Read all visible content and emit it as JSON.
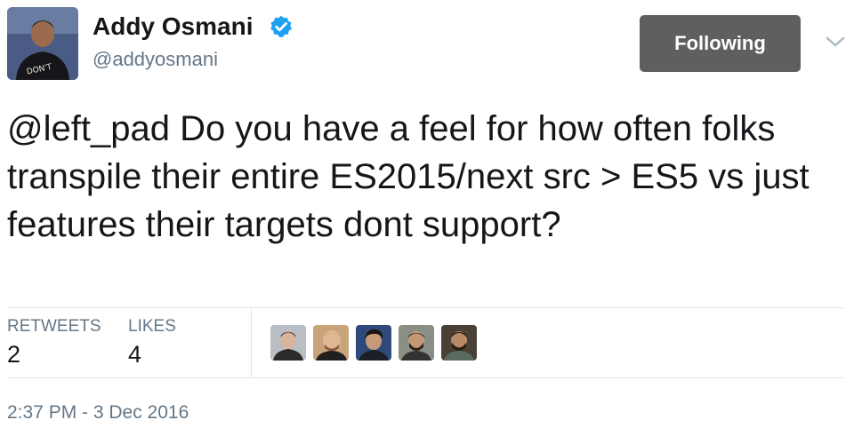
{
  "author": {
    "display_name": "Addy Osmani",
    "handle": "@addyosmani",
    "verified": true,
    "avatar_icon": "profile-photo"
  },
  "follow_button": {
    "label": "Following"
  },
  "menu": {
    "icon": "chevron-down-icon"
  },
  "tweet": {
    "text": "@left_pad Do you have a feel for how often folks transpile their entire ES2015/next src > ES5 vs just features their targets dont support?"
  },
  "stats": {
    "retweets_label": "RETWEETS",
    "retweets_count": "2",
    "likes_label": "LIKES",
    "likes_count": "4"
  },
  "likers": [
    "liker-avatar-1",
    "liker-avatar-2",
    "liker-avatar-3",
    "liker-avatar-4",
    "liker-avatar-5"
  ],
  "timestamp": "2:37 PM - 3 Dec 2016",
  "colors": {
    "verified_badge": "#1da1f2",
    "following_button_bg": "#5f5f5f",
    "secondary_text": "#657786",
    "divider": "#dfe3e8"
  }
}
